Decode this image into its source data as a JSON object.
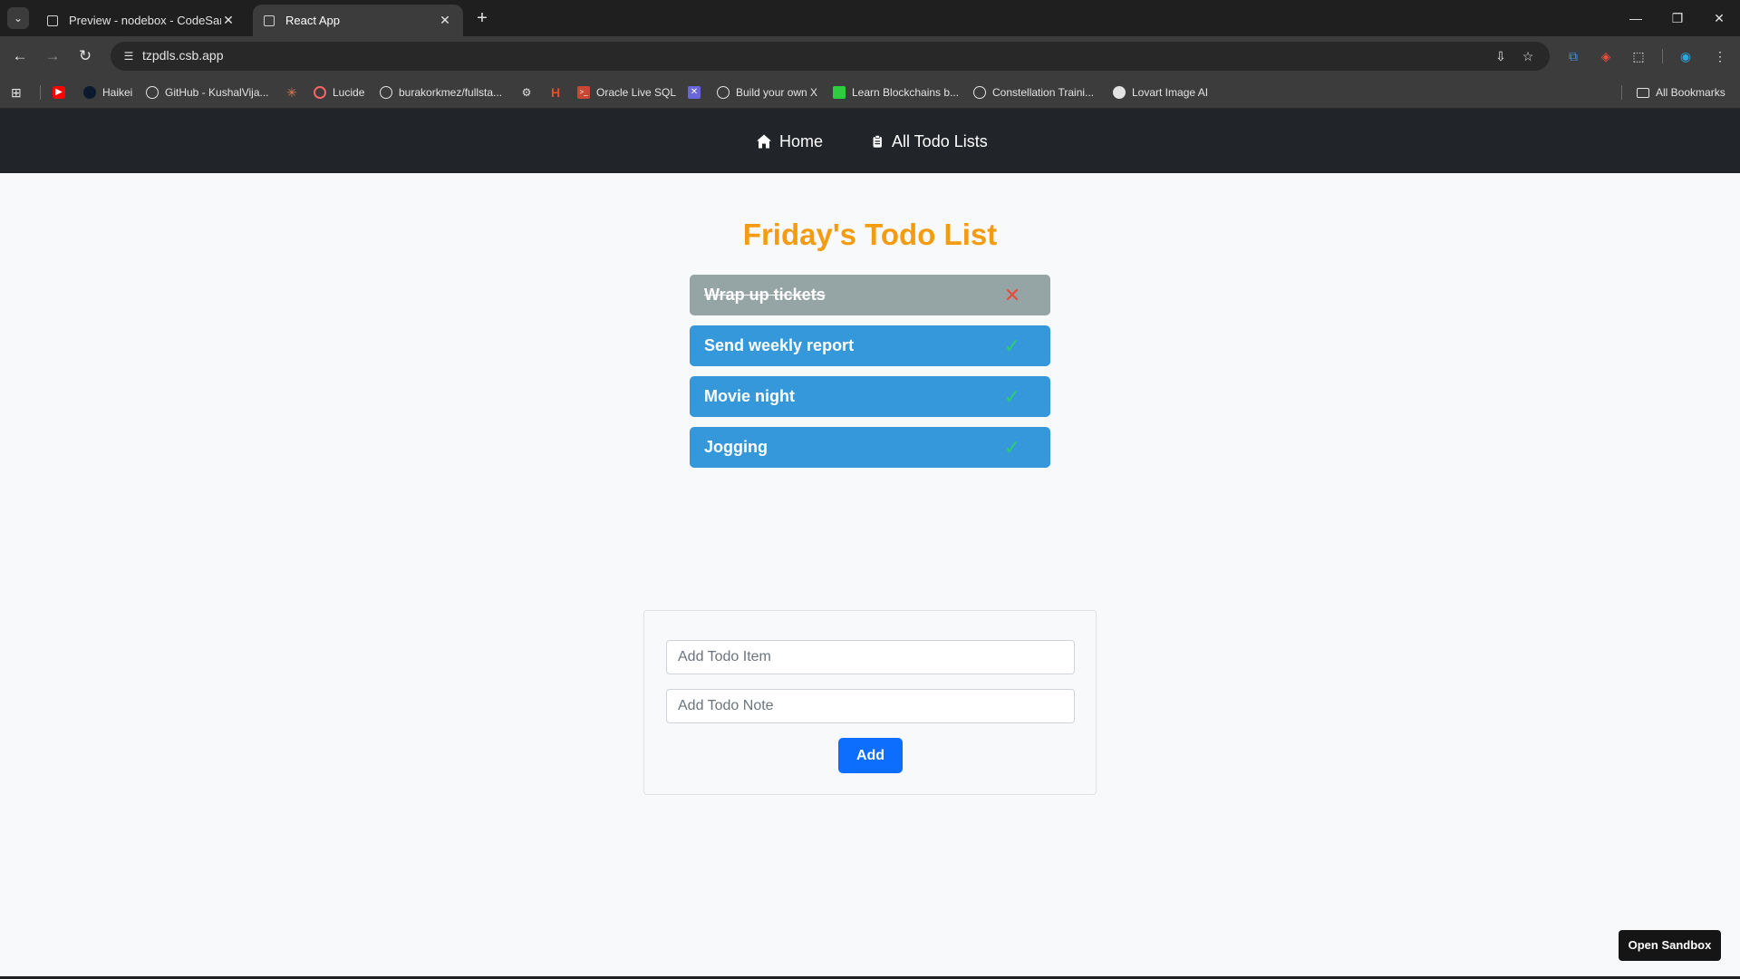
{
  "browser": {
    "tabs": [
      {
        "title": "Preview - nodebox - CodeSandbox",
        "active": false
      },
      {
        "title": "React App",
        "active": true
      }
    ],
    "url": "tzpdls.csb.app",
    "bookmarks": [
      {
        "label": "",
        "icon": "youtube-icon",
        "color": "#ff0000"
      },
      {
        "label": "Haikei",
        "icon": "haikei-icon",
        "color": "#0b1a2e"
      },
      {
        "label": "GitHub - KushalVija...",
        "icon": "github-icon",
        "color": "#e3e3e3"
      },
      {
        "label": "",
        "icon": "asterisk-icon",
        "color": "#d97757"
      },
      {
        "label": "Lucide",
        "icon": "lucide-icon",
        "color": "#f56565"
      },
      {
        "label": "burakorkmez/fullsta...",
        "icon": "github-icon",
        "color": "#e3e3e3"
      },
      {
        "label": "",
        "icon": "openai-icon",
        "color": "#e3e3e3"
      },
      {
        "label": "",
        "icon": "h-icon",
        "color": "#e44d26"
      },
      {
        "label": "Oracle Live SQL",
        "icon": "oracle-icon",
        "color": "#c74634"
      },
      {
        "label": "",
        "icon": "excalidraw-icon",
        "color": "#6965db"
      },
      {
        "label": "Build your own X",
        "icon": "github-icon",
        "color": "#e3e3e3"
      },
      {
        "label": "Learn Blockchains b...",
        "icon": "blockchain-icon",
        "color": "#2ecc40"
      },
      {
        "label": "Constellation Traini...",
        "icon": "globe-icon",
        "color": "#e3e3e3"
      },
      {
        "label": "Lovart Image AI",
        "icon": "lovart-icon",
        "color": "#e3e3e3"
      }
    ],
    "all_bookmarks_label": "All Bookmarks"
  },
  "nav": {
    "home_label": "Home",
    "all_lists_label": "All Todo Lists"
  },
  "list": {
    "title": "Friday's Todo List",
    "items": [
      {
        "text": "Wrap up tickets",
        "completed": true
      },
      {
        "text": "Send weekly report",
        "completed": false
      },
      {
        "text": "Movie night",
        "completed": false
      },
      {
        "text": "Jogging",
        "completed": false
      }
    ]
  },
  "form": {
    "item_placeholder": "Add Todo Item",
    "note_placeholder": "Add Todo Note",
    "add_label": "Add"
  },
  "open_sandbox_label": "Open Sandbox",
  "colors": {
    "title": "#f39c12",
    "todo_active": "#3498db",
    "todo_completed": "#95a5a6",
    "check": "#2ecc71",
    "cross": "#e74c3c",
    "primary_button": "#0d6efd",
    "navbar": "#212529"
  }
}
